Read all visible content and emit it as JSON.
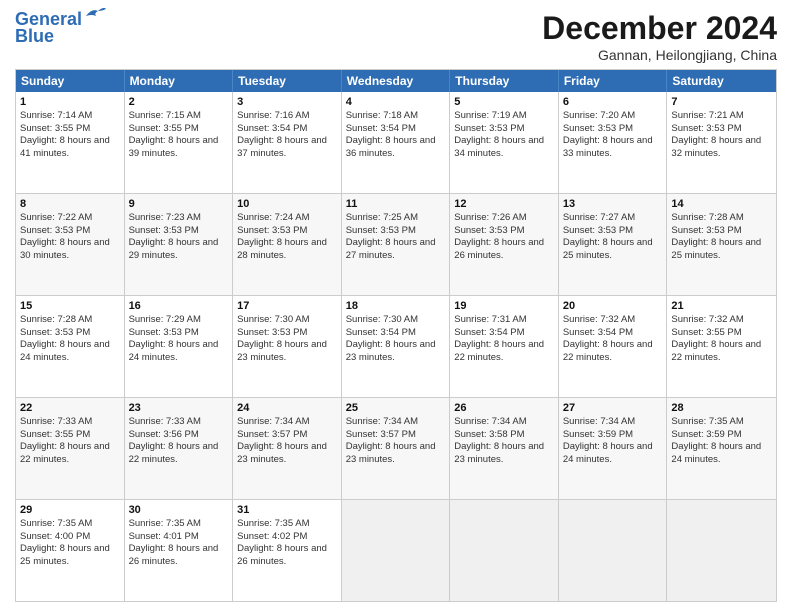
{
  "header": {
    "logo_line1": "General",
    "logo_line2": "Blue",
    "month": "December 2024",
    "location": "Gannan, Heilongjiang, China"
  },
  "days": [
    "Sunday",
    "Monday",
    "Tuesday",
    "Wednesday",
    "Thursday",
    "Friday",
    "Saturday"
  ],
  "weeks": [
    [
      {
        "day": "1",
        "rise": "7:14 AM",
        "set": "3:55 PM",
        "daylight": "8 hours and 41 minutes."
      },
      {
        "day": "2",
        "rise": "7:15 AM",
        "set": "3:55 PM",
        "daylight": "8 hours and 39 minutes."
      },
      {
        "day": "3",
        "rise": "7:16 AM",
        "set": "3:54 PM",
        "daylight": "8 hours and 37 minutes."
      },
      {
        "day": "4",
        "rise": "7:18 AM",
        "set": "3:54 PM",
        "daylight": "8 hours and 36 minutes."
      },
      {
        "day": "5",
        "rise": "7:19 AM",
        "set": "3:53 PM",
        "daylight": "8 hours and 34 minutes."
      },
      {
        "day": "6",
        "rise": "7:20 AM",
        "set": "3:53 PM",
        "daylight": "8 hours and 33 minutes."
      },
      {
        "day": "7",
        "rise": "7:21 AM",
        "set": "3:53 PM",
        "daylight": "8 hours and 32 minutes."
      }
    ],
    [
      {
        "day": "8",
        "rise": "7:22 AM",
        "set": "3:53 PM",
        "daylight": "8 hours and 30 minutes."
      },
      {
        "day": "9",
        "rise": "7:23 AM",
        "set": "3:53 PM",
        "daylight": "8 hours and 29 minutes."
      },
      {
        "day": "10",
        "rise": "7:24 AM",
        "set": "3:53 PM",
        "daylight": "8 hours and 28 minutes."
      },
      {
        "day": "11",
        "rise": "7:25 AM",
        "set": "3:53 PM",
        "daylight": "8 hours and 27 minutes."
      },
      {
        "day": "12",
        "rise": "7:26 AM",
        "set": "3:53 PM",
        "daylight": "8 hours and 26 minutes."
      },
      {
        "day": "13",
        "rise": "7:27 AM",
        "set": "3:53 PM",
        "daylight": "8 hours and 25 minutes."
      },
      {
        "day": "14",
        "rise": "7:28 AM",
        "set": "3:53 PM",
        "daylight": "8 hours and 25 minutes."
      }
    ],
    [
      {
        "day": "15",
        "rise": "7:28 AM",
        "set": "3:53 PM",
        "daylight": "8 hours and 24 minutes."
      },
      {
        "day": "16",
        "rise": "7:29 AM",
        "set": "3:53 PM",
        "daylight": "8 hours and 24 minutes."
      },
      {
        "day": "17",
        "rise": "7:30 AM",
        "set": "3:53 PM",
        "daylight": "8 hours and 23 minutes."
      },
      {
        "day": "18",
        "rise": "7:30 AM",
        "set": "3:54 PM",
        "daylight": "8 hours and 23 minutes."
      },
      {
        "day": "19",
        "rise": "7:31 AM",
        "set": "3:54 PM",
        "daylight": "8 hours and 22 minutes."
      },
      {
        "day": "20",
        "rise": "7:32 AM",
        "set": "3:54 PM",
        "daylight": "8 hours and 22 minutes."
      },
      {
        "day": "21",
        "rise": "7:32 AM",
        "set": "3:55 PM",
        "daylight": "8 hours and 22 minutes."
      }
    ],
    [
      {
        "day": "22",
        "rise": "7:33 AM",
        "set": "3:55 PM",
        "daylight": "8 hours and 22 minutes."
      },
      {
        "day": "23",
        "rise": "7:33 AM",
        "set": "3:56 PM",
        "daylight": "8 hours and 22 minutes."
      },
      {
        "day": "24",
        "rise": "7:34 AM",
        "set": "3:57 PM",
        "daylight": "8 hours and 23 minutes."
      },
      {
        "day": "25",
        "rise": "7:34 AM",
        "set": "3:57 PM",
        "daylight": "8 hours and 23 minutes."
      },
      {
        "day": "26",
        "rise": "7:34 AM",
        "set": "3:58 PM",
        "daylight": "8 hours and 23 minutes."
      },
      {
        "day": "27",
        "rise": "7:34 AM",
        "set": "3:59 PM",
        "daylight": "8 hours and 24 minutes."
      },
      {
        "day": "28",
        "rise": "7:35 AM",
        "set": "3:59 PM",
        "daylight": "8 hours and 24 minutes."
      }
    ],
    [
      {
        "day": "29",
        "rise": "7:35 AM",
        "set": "4:00 PM",
        "daylight": "8 hours and 25 minutes."
      },
      {
        "day": "30",
        "rise": "7:35 AM",
        "set": "4:01 PM",
        "daylight": "8 hours and 26 minutes."
      },
      {
        "day": "31",
        "rise": "7:35 AM",
        "set": "4:02 PM",
        "daylight": "8 hours and 26 minutes."
      },
      null,
      null,
      null,
      null
    ]
  ],
  "labels": {
    "sunrise": "Sunrise:",
    "sunset": "Sunset:",
    "daylight": "Daylight:"
  }
}
